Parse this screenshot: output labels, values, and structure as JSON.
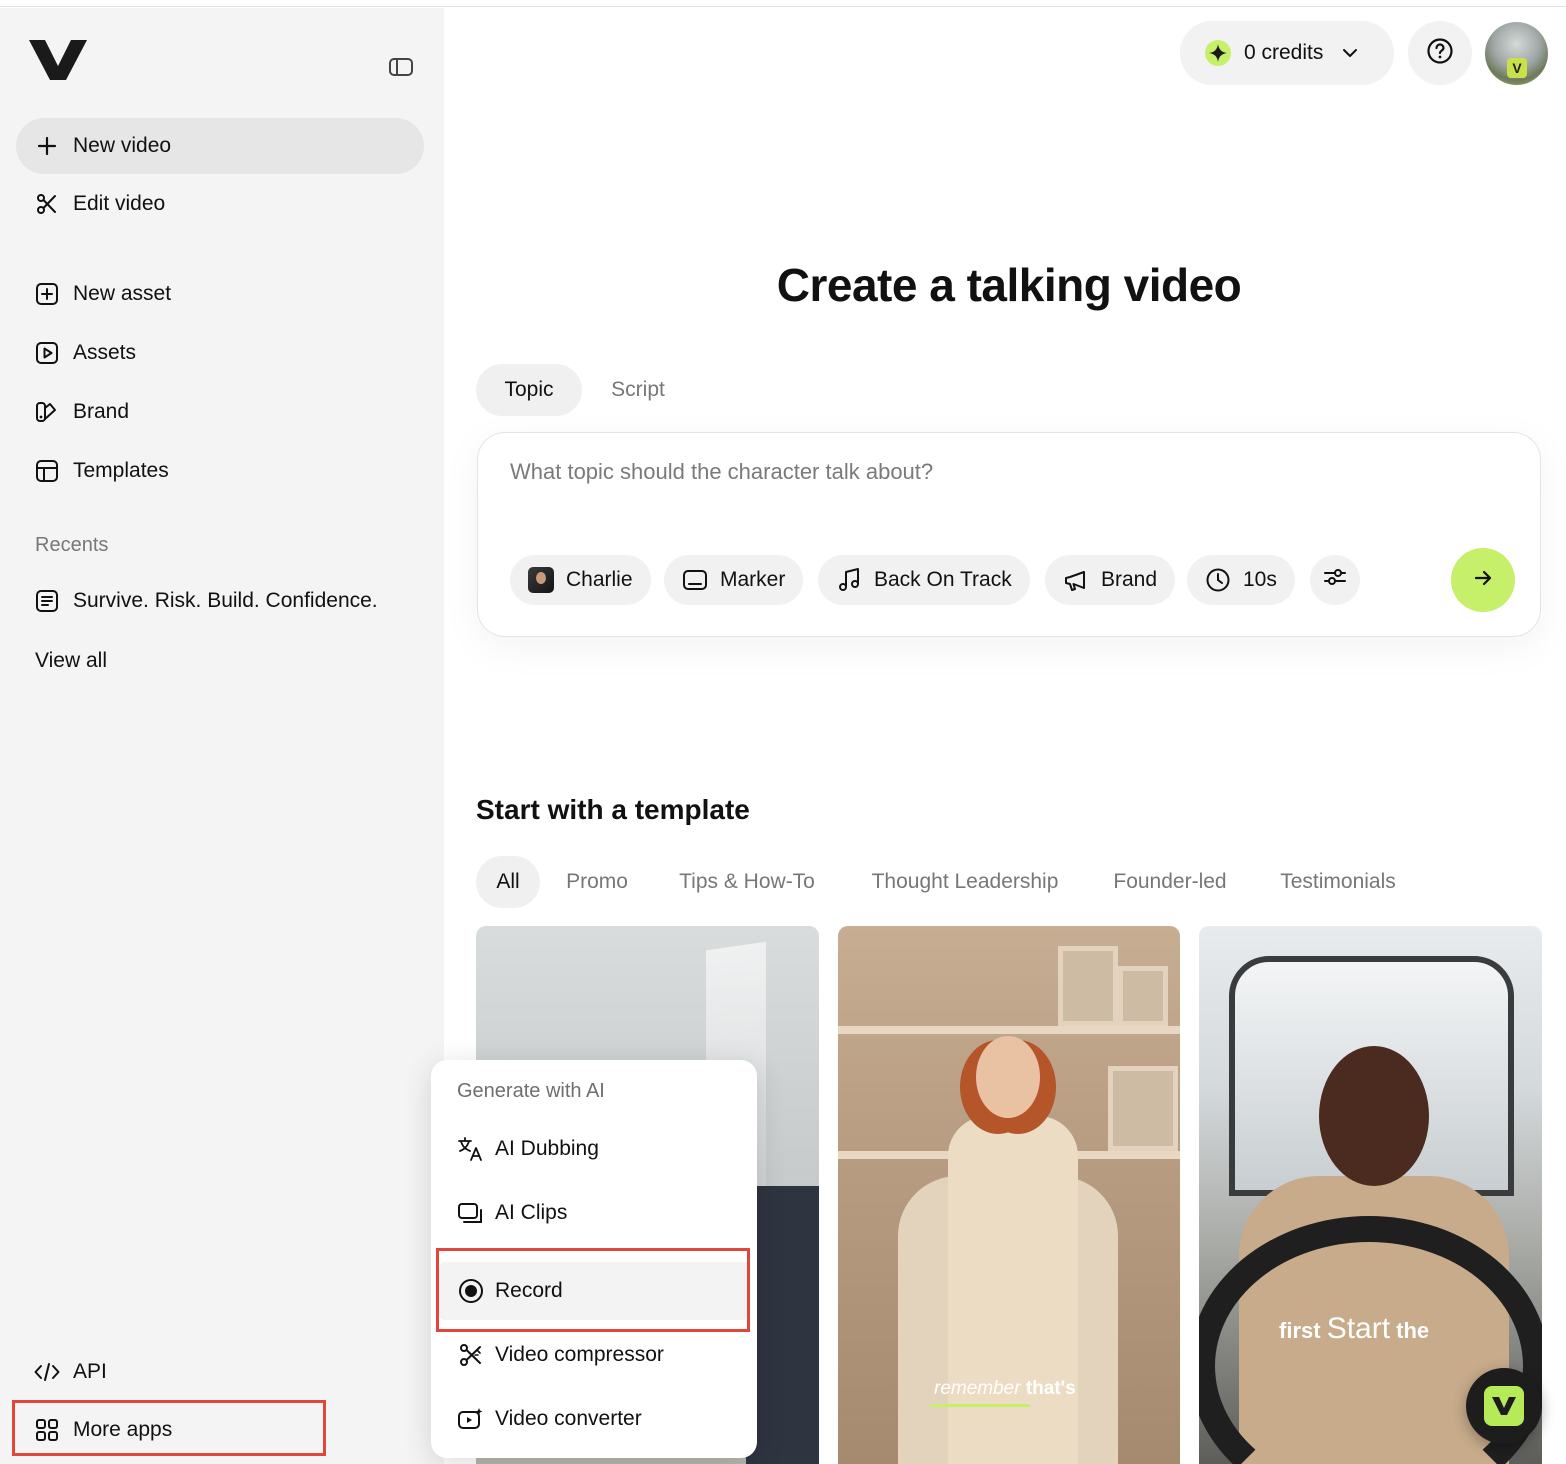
{
  "sidebar": {
    "new_video": "New video",
    "edit_video": "Edit video",
    "new_asset": "New asset",
    "assets": "Assets",
    "brand": "Brand",
    "templates": "Templates",
    "recents_label": "Recents",
    "recent_item": "Survive. Risk. Build. Confidence.",
    "view_all": "View all",
    "api": "API",
    "more_apps": "More apps"
  },
  "header": {
    "credits": "0 credits"
  },
  "main": {
    "title": "Create a talking video",
    "tabs": [
      "Topic",
      "Script"
    ],
    "prompt_placeholder": "What topic should the character talk about?",
    "chips": {
      "character": "Charlie",
      "caption_style": "Marker",
      "music": "Back On Track",
      "brand": "Brand",
      "duration": "10s"
    },
    "templates_title": "Start with a template",
    "filter_tabs": [
      "All",
      "Promo",
      "Tips & How-To",
      "Thought Leadership",
      "Founder-led",
      "Testimonials"
    ],
    "template_captions": {
      "card2_a": "remember",
      "card2_b": "that's",
      "card3_a": "first",
      "card3_b": "Start",
      "card3_c": "the"
    }
  },
  "menu": {
    "label": "Generate with AI",
    "items": [
      "AI Dubbing",
      "AI Clips",
      "Record",
      "Video compressor",
      "Video converter"
    ]
  },
  "colors": {
    "accent": "#c6ef6a",
    "highlight_box": "#e0463a",
    "sidebar_bg": "#f4f4f4"
  }
}
